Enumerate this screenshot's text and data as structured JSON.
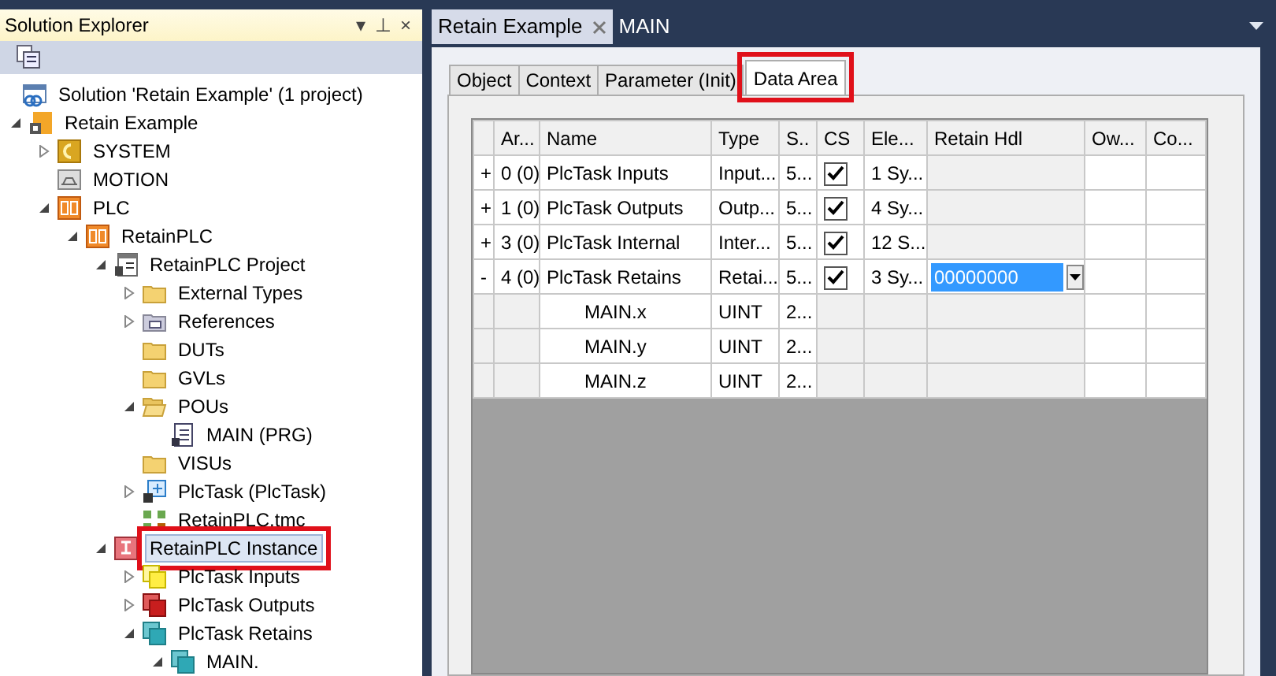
{
  "solution_explorer": {
    "title": "Solution Explorer",
    "buttons": [
      "▾",
      "⊥",
      "×"
    ],
    "tree": [
      {
        "label": "Solution 'Retain Example' (1 project)",
        "kind": "solution",
        "selected": false,
        "highlighted": false,
        "children": [
          {
            "label": "Retain Example",
            "kind": "project",
            "expanded": true,
            "selected": false,
            "highlighted": false,
            "children": [
              {
                "label": "SYSTEM",
                "kind": "system",
                "expanded": false,
                "selected": false,
                "highlighted": false
              },
              {
                "label": "MOTION",
                "kind": "motion",
                "selected": false,
                "highlighted": false
              },
              {
                "label": "PLC",
                "kind": "plc",
                "expanded": true,
                "selected": false,
                "highlighted": false,
                "children": [
                  {
                    "label": "RetainPLC",
                    "kind": "plc",
                    "expanded": true,
                    "selected": false,
                    "highlighted": false,
                    "children": [
                      {
                        "label": "RetainPLC Project",
                        "kind": "plcproject",
                        "expanded": true,
                        "selected": false,
                        "highlighted": false,
                        "children": [
                          {
                            "label": "External Types",
                            "kind": "folder",
                            "expanded": false,
                            "selected": false,
                            "highlighted": false
                          },
                          {
                            "label": "References",
                            "kind": "references",
                            "expanded": false,
                            "selected": false,
                            "highlighted": false
                          },
                          {
                            "label": "DUTs",
                            "kind": "folder",
                            "selected": false,
                            "highlighted": false
                          },
                          {
                            "label": "GVLs",
                            "kind": "folder",
                            "selected": false,
                            "highlighted": false
                          },
                          {
                            "label": "POUs",
                            "kind": "openfolder",
                            "expanded": true,
                            "selected": false,
                            "highlighted": false,
                            "children": [
                              {
                                "label": "MAIN (PRG)",
                                "kind": "pou",
                                "selected": false,
                                "highlighted": false
                              }
                            ]
                          },
                          {
                            "label": "VISUs",
                            "kind": "folder",
                            "selected": false,
                            "highlighted": false
                          },
                          {
                            "label": "PlcTask (PlcTask)",
                            "kind": "task",
                            "expanded": false,
                            "selected": false,
                            "highlighted": false
                          },
                          {
                            "label": "RetainPLC.tmc",
                            "kind": "tmc",
                            "selected": false,
                            "highlighted": false
                          }
                        ]
                      },
                      {
                        "label": "RetainPLC Instance",
                        "kind": "instance",
                        "expanded": true,
                        "selected": true,
                        "highlighted": true,
                        "children": [
                          {
                            "label": "PlcTask Inputs",
                            "kind": "inputs",
                            "expanded": false,
                            "selected": false,
                            "highlighted": false
                          },
                          {
                            "label": "PlcTask Outputs",
                            "kind": "outputs",
                            "expanded": false,
                            "selected": false,
                            "highlighted": false
                          },
                          {
                            "label": "PlcTask Retains",
                            "kind": "retains",
                            "expanded": true,
                            "selected": false,
                            "highlighted": false,
                            "children": [
                              {
                                "label": "MAIN.",
                                "kind": "retains",
                                "expanded": true,
                                "selected": false,
                                "highlighted": false
                              }
                            ]
                          }
                        ]
                      }
                    ]
                  }
                ]
              }
            ]
          }
        ]
      }
    ]
  },
  "document_tabs": [
    {
      "label": "Retain Example",
      "selected": true
    },
    {
      "label": "MAIN",
      "selected": false
    }
  ],
  "property_tabs": [
    {
      "label": "Object",
      "selected": false,
      "highlighted": false
    },
    {
      "label": "Context",
      "selected": false,
      "highlighted": false
    },
    {
      "label": "Parameter (Init)",
      "selected": false,
      "highlighted": false
    },
    {
      "label": "Data Area",
      "selected": true,
      "highlighted": true
    }
  ],
  "table": {
    "columns": [
      "",
      "Ar...",
      "Name",
      "Type",
      "S..",
      "CS",
      "Ele...",
      "Retain Hdl",
      "Ow...",
      "Co..."
    ],
    "rows": [
      {
        "kind": "group",
        "expander": "+",
        "area": "0 (0)",
        "name": "PlcTask Inputs",
        "type": "Input...",
        "size": "5...",
        "checked": true,
        "elements": "1 Sy..."
      },
      {
        "kind": "group",
        "expander": "+",
        "area": "1 (0)",
        "name": "PlcTask Outputs",
        "type": "Outp...",
        "size": "5...",
        "checked": true,
        "elements": "4 Sy..."
      },
      {
        "kind": "group",
        "expander": "+",
        "area": "3 (0)",
        "name": "PlcTask Internal",
        "type": "Inter...",
        "size": "5...",
        "checked": true,
        "elements": "12 S..."
      },
      {
        "kind": "group",
        "expander": "-",
        "area": "4 (0)",
        "name": "PlcTask Retains",
        "type": "Retai...",
        "size": "5...",
        "checked": true,
        "elements": "3 Sy...",
        "retain_hdl": "00000000"
      },
      {
        "kind": "member",
        "name": "MAIN.x",
        "type": "UINT",
        "size": "2..."
      },
      {
        "kind": "member",
        "name": "MAIN.y",
        "type": "UINT",
        "size": "2..."
      },
      {
        "kind": "member",
        "name": "MAIN.z",
        "type": "UINT",
        "size": "2..."
      }
    ]
  }
}
